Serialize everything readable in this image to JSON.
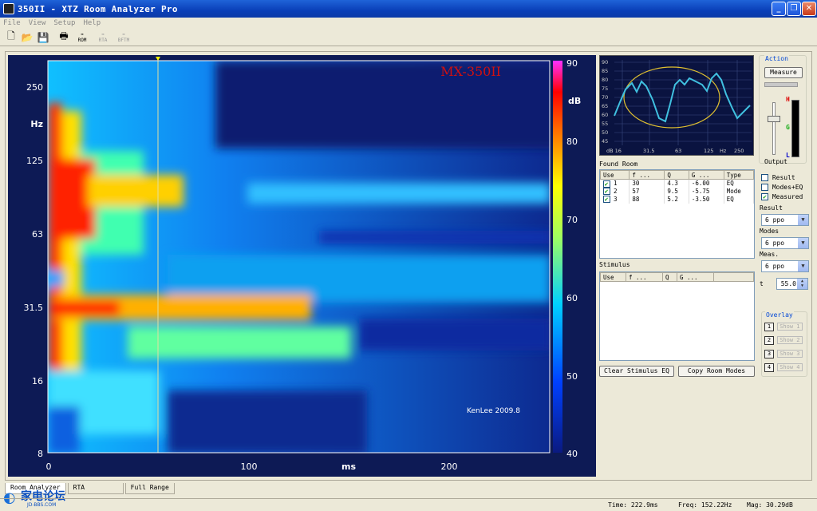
{
  "window": {
    "title": "350II - XTZ Room Analyzer Pro",
    "minimize": "_",
    "restore": "❐",
    "close": "✕"
  },
  "menu": [
    "File",
    "View",
    "Setup",
    "Help"
  ],
  "toolbar": {
    "new": "🗋",
    "open": "📂",
    "save": "💾",
    "print": "🖶",
    "rom": "ROM",
    "rta": "RTA",
    "bftm": "BFTM"
  },
  "waterfall": {
    "label": "MX-350II",
    "y_unit": "Hz",
    "x_unit": "ms",
    "y_ticks": [
      "250",
      "125",
      "63",
      "31.5",
      "16",
      "8"
    ],
    "x_ticks": [
      "0",
      "100",
      "200"
    ],
    "colorbar_unit": "dB",
    "colorbar_ticks": [
      "90",
      "80",
      "70",
      "60",
      "50",
      "40"
    ],
    "watermark": "KenLee 2009.8"
  },
  "spectrum": {
    "y_ticks": [
      "90",
      "85",
      "80",
      "75",
      "70",
      "65",
      "60",
      "55",
      "50",
      "45"
    ],
    "x_ticks": [
      "dB 16",
      "31.5",
      "63",
      "125",
      "Hz",
      "250"
    ]
  },
  "action": {
    "label": "Action",
    "measure_button": "Measure",
    "output_label": "Output",
    "meter_h": "H",
    "meter_g": "G",
    "meter_l": "L"
  },
  "found_room": {
    "label": "Found Room",
    "columns": [
      "Use",
      "f ...",
      "Q",
      "G ...",
      "Type"
    ],
    "rows": [
      {
        "use": "1",
        "f": "30",
        "q": "4.3",
        "g": "-6.00",
        "type": "EQ"
      },
      {
        "use": "2",
        "f": "57",
        "q": "9.5",
        "g": "-5.75",
        "type": "Mode"
      },
      {
        "use": "3",
        "f": "88",
        "q": "5.2",
        "g": "-3.50",
        "type": "EQ"
      }
    ]
  },
  "stimulus": {
    "label": "Stimulus",
    "columns": [
      "Use",
      "f ...",
      "Q",
      "G ..."
    ]
  },
  "buttons": {
    "clear_stimulus": "Clear Stimulus EQ",
    "copy_room": "Copy Room Modes"
  },
  "options": {
    "result_check": "Result",
    "modes_eq_check": "Modes+EQ",
    "measured_check": "Measured",
    "result_label": "Result",
    "result_value": "6 ppo",
    "modes_label": "Modes",
    "modes_value": "6 ppo",
    "meas_label": "Meas.",
    "meas_value": "6 ppo",
    "t_label": "t",
    "t_value": "55.0"
  },
  "overlay": {
    "label": "Overlay",
    "items": [
      {
        "num": "1",
        "label": "Show 1"
      },
      {
        "num": "2",
        "label": "Show 2"
      },
      {
        "num": "3",
        "label": "Show 3"
      },
      {
        "num": "4",
        "label": "Show 4"
      }
    ]
  },
  "tabs": [
    "Room Analyzer",
    "RTA",
    "Full Range"
  ],
  "status": {
    "time": "Time: 222.9ms",
    "freq": "Freq: 152.22Hz",
    "mag": "Mag: 30.29dB"
  },
  "logo": {
    "text": "家电论坛",
    "sub": "JD-BBS.COM"
  }
}
